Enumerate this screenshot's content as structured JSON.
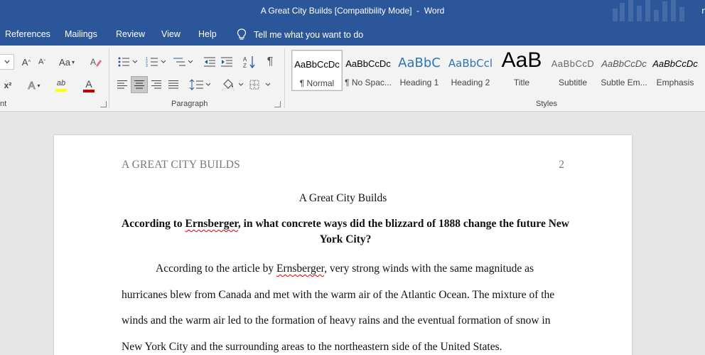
{
  "window": {
    "title": "A Great City Builds [Compatibility Mode]",
    "separator": "-",
    "app_name": "Word",
    "user_initial": "n",
    "title_color": "#2b579a"
  },
  "menu": {
    "tabs": [
      "References",
      "Mailings",
      "Review",
      "View",
      "Help"
    ],
    "tell_me": "Tell me what you want to do"
  },
  "ribbon": {
    "font_group_label": "nt",
    "paragraph_group_label": "Paragraph",
    "styles_group_label": "Styles",
    "font_buttons": {
      "grow": "A",
      "shrink": "A",
      "change_case": "Aa",
      "superscript": "x²",
      "text_effects": "A",
      "highlight": "ab",
      "font_color": "A"
    },
    "styles": [
      {
        "preview": "AaBbCcDc",
        "label": "¶ Normal",
        "selected": true
      },
      {
        "preview": "AaBbCcDc",
        "label": "¶ No Spac...",
        "selected": false
      },
      {
        "preview": "AaBbC",
        "label": "Heading 1",
        "selected": false
      },
      {
        "preview": "AaBbCcl",
        "label": "Heading 2",
        "selected": false
      },
      {
        "preview": "AaB",
        "label": "Title",
        "selected": false
      },
      {
        "preview": "AaBbCcD",
        "label": "Subtitle",
        "selected": false
      },
      {
        "preview": "AaBbCcDc",
        "label": "Subtle Em...",
        "selected": false
      },
      {
        "preview": "AaBbCcDc",
        "label": "Emphasis",
        "selected": false
      }
    ]
  },
  "document": {
    "header_left": "A GREAT CITY BUILDS",
    "page_number": "2",
    "title": "A Great City Builds",
    "question": {
      "part1": "According to ",
      "name": "Ernsberger",
      "part2": ", in what concrete ways did the blizzard of 1888 change the future New York City?"
    },
    "paragraph": {
      "part1": "According to the article by ",
      "name": "Ernsberger",
      "part2": ", very strong winds with the same magnitude as hurricanes blew from Canada and met with the warm air of the Atlantic Ocean. The mixture of the winds and the warm air led to the formation of heavy rains and the eventual formation of snow in New York City and the surrounding areas to the northeastern side of the United States."
    }
  }
}
